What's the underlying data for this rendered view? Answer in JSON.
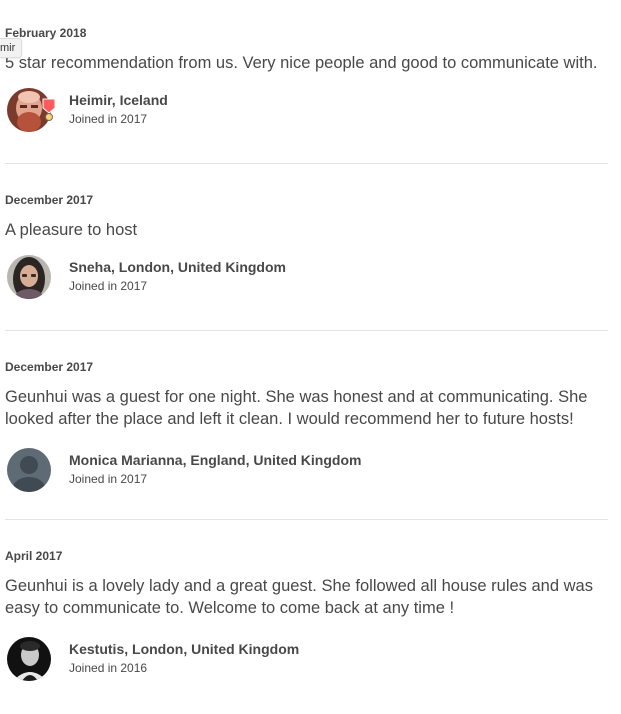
{
  "tooltip": "mir",
  "reviews": [
    {
      "date": "February 2018",
      "text": "5 star recommendation from us. Very nice people and good to communicate with.",
      "reviewer": {
        "name": "Heimir, Iceland",
        "joined": "Joined in 2017",
        "avatar_icon": "profile-photo-man-red-beard",
        "badge_icon": "superhost-badge"
      }
    },
    {
      "date": "December 2017",
      "text": "A pleasure to host",
      "reviewer": {
        "name": "Sneha, London, United Kingdom",
        "joined": "Joined in 2017",
        "avatar_icon": "profile-photo-woman-dark-hair"
      }
    },
    {
      "date": "December 2017",
      "text": "Geunhui was a guest for one night. She was honest and at communicating. She looked after the place and left it clean. I would recommend her to future hosts!",
      "reviewer": {
        "name": "Monica Marianna, England, United Kingdom",
        "joined": "Joined in 2017",
        "avatar_icon": "default-user-silhouette"
      }
    },
    {
      "date": "April 2017",
      "text": "Geunhui is a lovely lady and a great guest. She followed all house rules and was easy to communicate to. Welcome to come back at any time !",
      "reviewer": {
        "name": "Kestutis, London, United Kingdom",
        "joined": "Joined in 2016",
        "avatar_icon": "profile-photo-man-black-and-white"
      }
    }
  ],
  "colors": {
    "text": "#484848",
    "divider": "#e4e4e4",
    "badge": "#ff5a5f"
  }
}
